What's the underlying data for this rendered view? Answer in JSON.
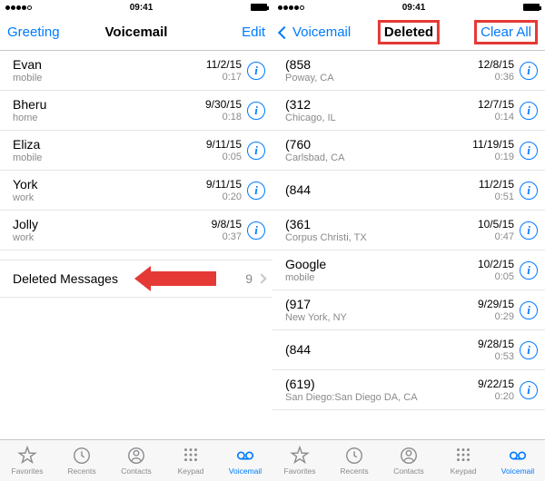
{
  "status": {
    "time": "09:41"
  },
  "left": {
    "nav": {
      "left": "Greeting",
      "title": "Voicemail",
      "right": "Edit"
    },
    "items": [
      {
        "name": "Evan",
        "sub": "mobile",
        "date": "11/2/15",
        "dur": "0:17"
      },
      {
        "name": "Bheru",
        "sub": "home",
        "date": "9/30/15",
        "dur": "0:18"
      },
      {
        "name": "Eliza",
        "sub": "mobile",
        "date": "9/11/15",
        "dur": "0:05"
      },
      {
        "name": "York",
        "sub": "work",
        "date": "9/11/15",
        "dur": "0:20"
      },
      {
        "name": "Jolly",
        "sub": "work",
        "date": "9/8/15",
        "dur": "0:37"
      }
    ],
    "deleted": {
      "label": "Deleted Messages",
      "count": "9"
    }
  },
  "right": {
    "nav": {
      "back": "Voicemail",
      "title": "Deleted",
      "right": "Clear All"
    },
    "items": [
      {
        "name": "(858",
        "sub": "Poway, CA",
        "date": "12/8/15",
        "dur": "0:36"
      },
      {
        "name": "(312",
        "sub": "Chicago, IL",
        "date": "12/7/15",
        "dur": "0:14"
      },
      {
        "name": "(760",
        "sub": "Carlsbad, CA",
        "date": "11/19/15",
        "dur": "0:19"
      },
      {
        "name": "(844",
        "sub": "",
        "date": "11/2/15",
        "dur": "0:51"
      },
      {
        "name": "(361",
        "sub": "Corpus Christi, TX",
        "date": "10/5/15",
        "dur": "0:47"
      },
      {
        "name": "Google",
        "sub": "mobile",
        "date": "10/2/15",
        "dur": "0:05"
      },
      {
        "name": "(917",
        "sub": "New York, NY",
        "date": "9/29/15",
        "dur": "0:29"
      },
      {
        "name": "(844",
        "sub": "",
        "date": "9/28/15",
        "dur": "0:53"
      },
      {
        "name": "(619)",
        "sub": "San Diego:San Diego DA, CA",
        "date": "9/22/15",
        "dur": "0:20"
      }
    ]
  },
  "tabs": [
    {
      "label": "Favorites"
    },
    {
      "label": "Recents"
    },
    {
      "label": "Contacts"
    },
    {
      "label": "Keypad"
    },
    {
      "label": "Voicemail"
    }
  ]
}
